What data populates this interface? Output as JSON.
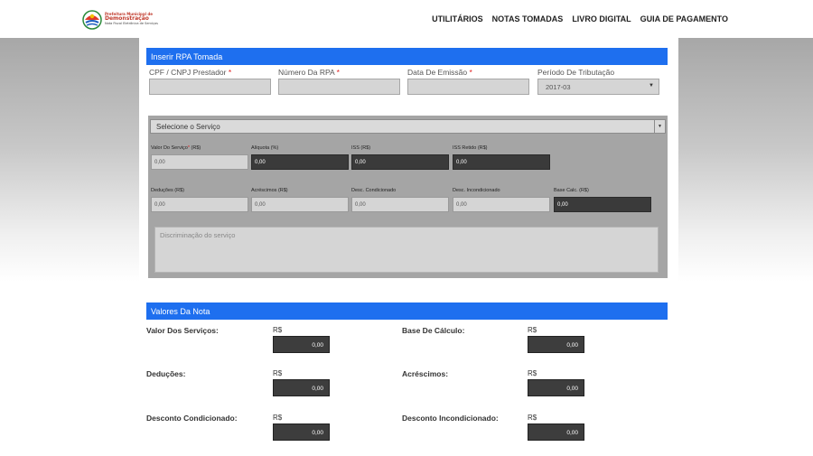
{
  "header": {
    "logo": {
      "line1": "Prefeitura Municipal de",
      "line2": "Demonstração",
      "line3": "Nota Fiscal Eletrônica de Serviços"
    },
    "nav": [
      "UTILITÁRIOS",
      "NOTAS TOMADAS",
      "LIVRO DIGITAL",
      "GUIA DE PAGAMENTO"
    ]
  },
  "rpa": {
    "title": "Inserir RPA Tomada",
    "fields": [
      {
        "label": "CPF / CNPJ Prestador",
        "required": "*",
        "value": ""
      },
      {
        "label": "Número Da RPA",
        "required": "*",
        "value": ""
      },
      {
        "label": "Data De Emissão",
        "required": "*",
        "value": ""
      },
      {
        "label": "Período De Tributação",
        "required": "",
        "value": "2017-03"
      }
    ]
  },
  "service": {
    "select_label": "Selecione o Serviço",
    "row1": [
      {
        "label": "Valor Do Serviço",
        "required": "*",
        "suffix": " (R$)",
        "value": "0,00"
      },
      {
        "label": "Alíquota (%)",
        "required": "",
        "suffix": "",
        "value": "0,00"
      },
      {
        "label": "ISS (R$)",
        "required": "",
        "suffix": "",
        "value": "0,00"
      },
      {
        "label": "ISS Retido (R$)",
        "required": "",
        "suffix": "",
        "value": "0,00"
      }
    ],
    "row2": [
      {
        "label": "Deduções (R$)",
        "value": "0,00"
      },
      {
        "label": "Acréscimos (R$)",
        "value": "0,00"
      },
      {
        "label": "Desc. Condicionado",
        "value": "0,00"
      },
      {
        "label": "Desc. Incondicionado",
        "value": "0,00"
      },
      {
        "label": "Base Calc. (R$)",
        "value": "0,00"
      }
    ],
    "description_placeholder": "Discriminação do serviço"
  },
  "values": {
    "title": "Valores Da Nota",
    "currency": "R$",
    "items": [
      {
        "label": "Valor Dos Serviços:",
        "value": "0,00"
      },
      {
        "label": "Base De Cálculo:",
        "value": "0,00"
      },
      {
        "label": "Deduções:",
        "value": "0,00"
      },
      {
        "label": "Acréscimos:",
        "value": "0,00"
      },
      {
        "label": "Desconto Condicionado:",
        "value": "0,00"
      },
      {
        "label": "Desconto Incondicionado:",
        "value": "0,00"
      }
    ]
  },
  "colors": {
    "section_bar": "#1e6fef",
    "required_mark": "#e02020",
    "dark_input": "#3a3a3a"
  }
}
